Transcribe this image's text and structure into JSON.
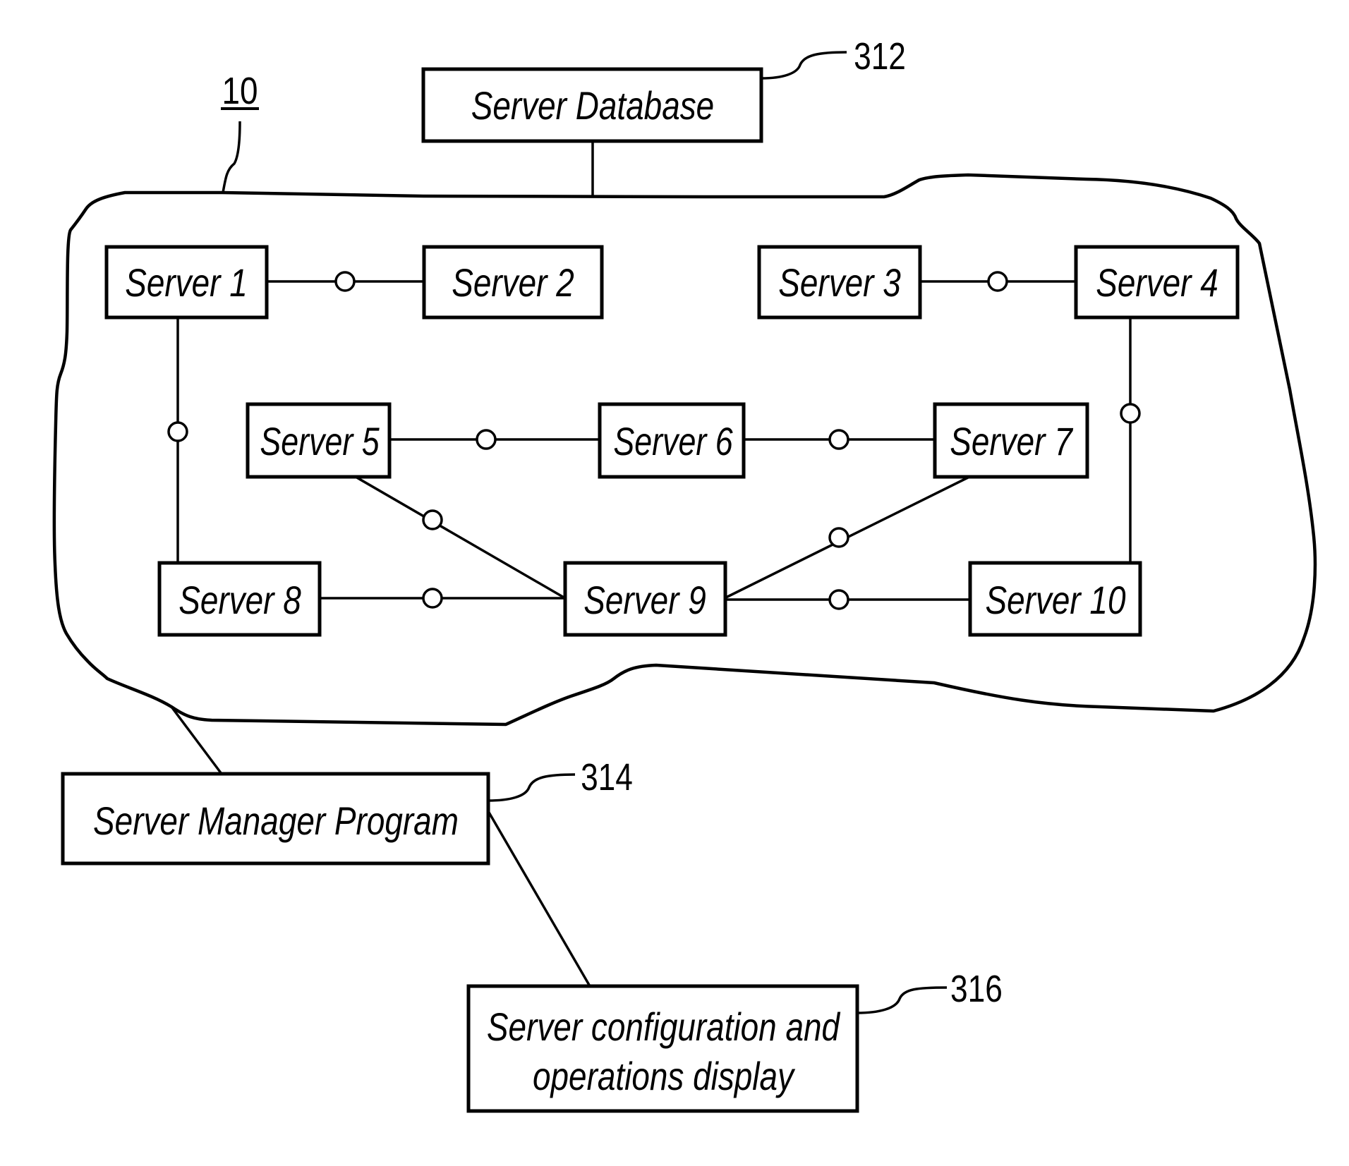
{
  "figure": {
    "system_ref": "10",
    "colors": {
      "ink": "#000000",
      "paper": "#ffffff"
    }
  },
  "server_database": {
    "label": "Server Database",
    "ref": "312"
  },
  "servers": [
    {
      "id": 1,
      "label": "Server 1"
    },
    {
      "id": 2,
      "label": "Server 2"
    },
    {
      "id": 3,
      "label": "Server 3"
    },
    {
      "id": 4,
      "label": "Server 4"
    },
    {
      "id": 5,
      "label": "Server 5"
    },
    {
      "id": 6,
      "label": "Server 6"
    },
    {
      "id": 7,
      "label": "Server 7"
    },
    {
      "id": 8,
      "label": "Server 8"
    },
    {
      "id": 9,
      "label": "Server 9"
    },
    {
      "id": 10,
      "label": "Server 10"
    }
  ],
  "connections": [
    {
      "from": 1,
      "to": 2
    },
    {
      "from": 3,
      "to": 4
    },
    {
      "from": 1,
      "to": 8
    },
    {
      "from": 4,
      "to": 10
    },
    {
      "from": 5,
      "to": 6
    },
    {
      "from": 6,
      "to": 7
    },
    {
      "from": 5,
      "to": 9
    },
    {
      "from": 7,
      "to": 9
    },
    {
      "from": 8,
      "to": 9
    },
    {
      "from": 9,
      "to": 10
    }
  ],
  "server_manager": {
    "label": "Server Manager Program",
    "ref": "314"
  },
  "config_display": {
    "label_line1": "Server configuration and",
    "label_line2": "operations display",
    "ref": "316"
  }
}
